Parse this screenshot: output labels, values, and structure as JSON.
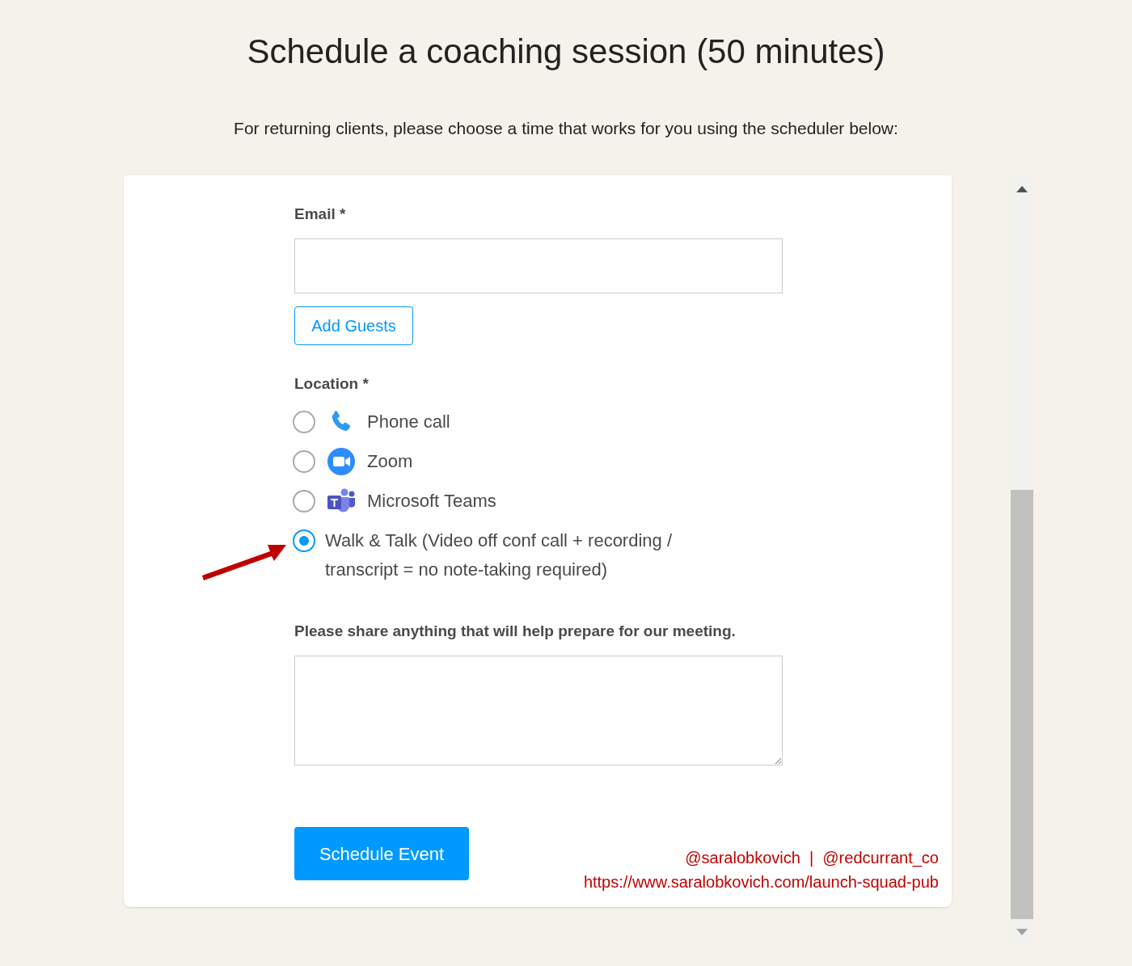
{
  "title": "Schedule a coaching session (50 minutes)",
  "intro": "For returning clients, please choose a time that works for you using the scheduler below:",
  "form": {
    "email": {
      "label": "Email *"
    },
    "add_guests": "Add Guests",
    "location": {
      "label": "Location *",
      "options": [
        {
          "kind": "phone",
          "label": "Phone call",
          "selected": false
        },
        {
          "kind": "zoom",
          "label": "Zoom",
          "selected": false
        },
        {
          "kind": "teams",
          "label": "Microsoft Teams",
          "selected": false
        },
        {
          "kind": "plain",
          "label": "Walk & Talk (Video off conf call + recording / transcript = no note-taking required)",
          "selected": true
        }
      ]
    },
    "notes": {
      "label": "Please share anything that will help prepare for our meeting."
    },
    "submit": "Schedule Event"
  },
  "credit": {
    "handles": "@saralobkovich  |  @redcurrant_co",
    "url": "https://www.saralobkovich.com/launch-squad-pub"
  }
}
